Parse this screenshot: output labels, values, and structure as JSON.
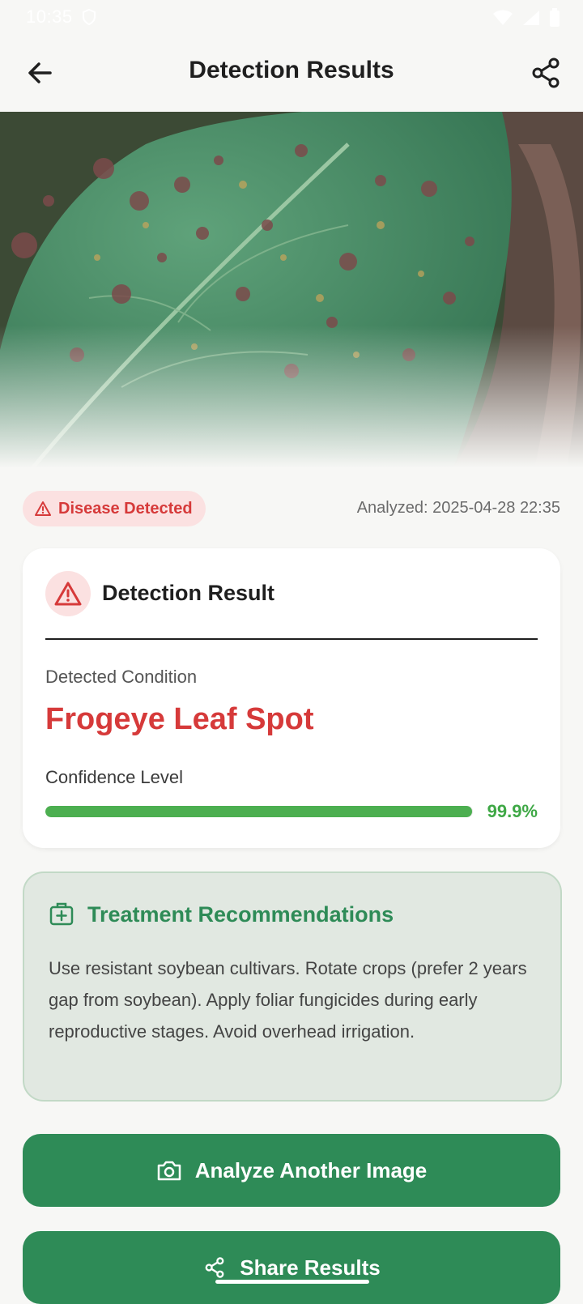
{
  "status_bar": {
    "time": "10:35"
  },
  "app_bar": {
    "title": "Detection Results",
    "back_icon": "arrow-left-icon",
    "share_icon": "share-icon"
  },
  "hero": {
    "description_icon": "leaf-photo"
  },
  "badge": {
    "label": "Disease Detected",
    "icon": "warning-triangle-icon",
    "color": "#d63a3a"
  },
  "analyzed_text": "Analyzed: 2025-04-28 22:35",
  "result_card": {
    "title": "Detection Result",
    "condition_label": "Detected Condition",
    "condition_value": "Frogeye Leaf Spot",
    "confidence_label": "Confidence Level",
    "confidence_value": "99.9%",
    "confidence_fraction": 0.999
  },
  "treatment": {
    "title": "Treatment Recommendations",
    "body": "Use resistant soybean cultivars. Rotate crops (prefer 2 years gap from soybean). Apply foliar fungicides during early reproductive stages. Avoid overhead irrigation."
  },
  "buttons": {
    "analyze_label": "Analyze Another Image",
    "share_label": "Share Results"
  },
  "colors": {
    "accent_green": "#2e8b57",
    "danger_red": "#d63a3a",
    "progress_green": "#4caf50"
  }
}
